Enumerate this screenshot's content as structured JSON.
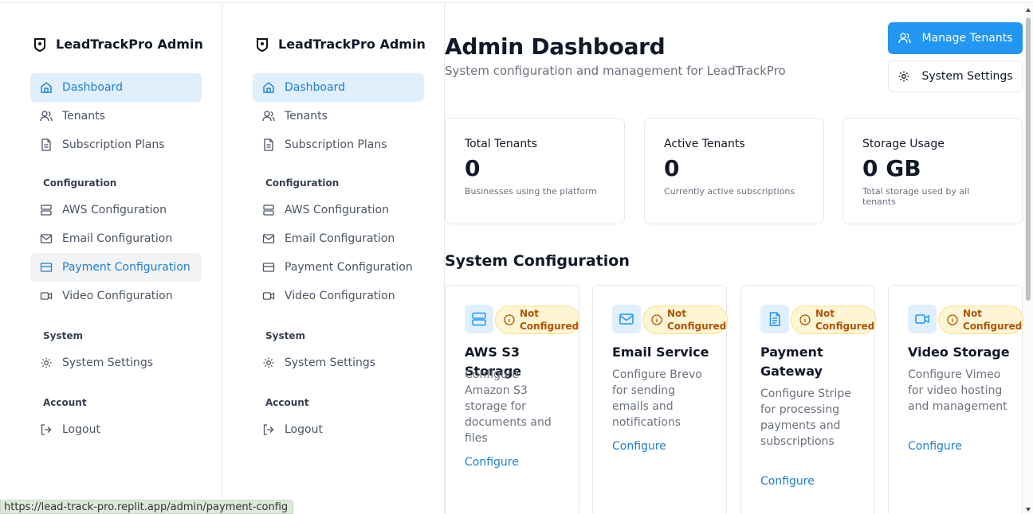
{
  "brand": {
    "title": "LeadTrackPro Admin"
  },
  "sidebar": {
    "primary": [
      {
        "label": "Dashboard",
        "icon": "home-icon"
      },
      {
        "label": "Tenants",
        "icon": "users-icon"
      },
      {
        "label": "Subscription Plans",
        "icon": "file-icon"
      }
    ],
    "configuration_label": "Configuration",
    "configuration": [
      {
        "label": "AWS Configuration",
        "icon": "server-icon"
      },
      {
        "label": "Email Configuration",
        "icon": "mail-icon"
      },
      {
        "label": "Payment Configuration",
        "icon": "credit-card-icon"
      },
      {
        "label": "Video Configuration",
        "icon": "video-icon"
      }
    ],
    "system_label": "System",
    "system": [
      {
        "label": "System Settings",
        "icon": "gear-icon"
      }
    ],
    "account_label": "Account",
    "account": [
      {
        "label": "Logout",
        "icon": "logout-icon"
      }
    ]
  },
  "header": {
    "title": "Admin Dashboard",
    "subtitle": "System configuration and management for LeadTrackPro",
    "manage_tenants": "Manage Tenants",
    "system_settings": "System Settings"
  },
  "stats": [
    {
      "label": "Total Tenants",
      "value": "0",
      "desc": "Businesses using the platform"
    },
    {
      "label": "Active Tenants",
      "value": "0",
      "desc": "Currently active subscriptions"
    },
    {
      "label": "Storage Usage",
      "value": "0 GB",
      "desc": "Total storage used by all tenants"
    }
  ],
  "config_section": {
    "title": "System Configuration",
    "badge_line1": "Not",
    "badge_line2": "Configured",
    "link": "Configure",
    "cards": [
      {
        "title": "AWS S3 Storage",
        "desc": "Configure Amazon S3 storage for documents and files",
        "icon": "server-icon"
      },
      {
        "title": "Email Service",
        "desc": "Configure Brevo for sending emails and notifications",
        "icon": "mail-icon"
      },
      {
        "title": "Payment Gateway",
        "desc": "Configure Stripe for processing payments and subscriptions",
        "icon": "document-icon"
      },
      {
        "title": "Video Storage",
        "desc": "Configure Vimeo for video hosting and management",
        "icon": "video-icon"
      }
    ]
  },
  "statusbar": {
    "url": "https://lead-track-pro.replit.app/admin/payment-config"
  },
  "colors": {
    "accent": "#2196f3",
    "link": "#1d7fd0",
    "badge_bg": "#fdf5d3",
    "badge_text": "#b45309"
  }
}
